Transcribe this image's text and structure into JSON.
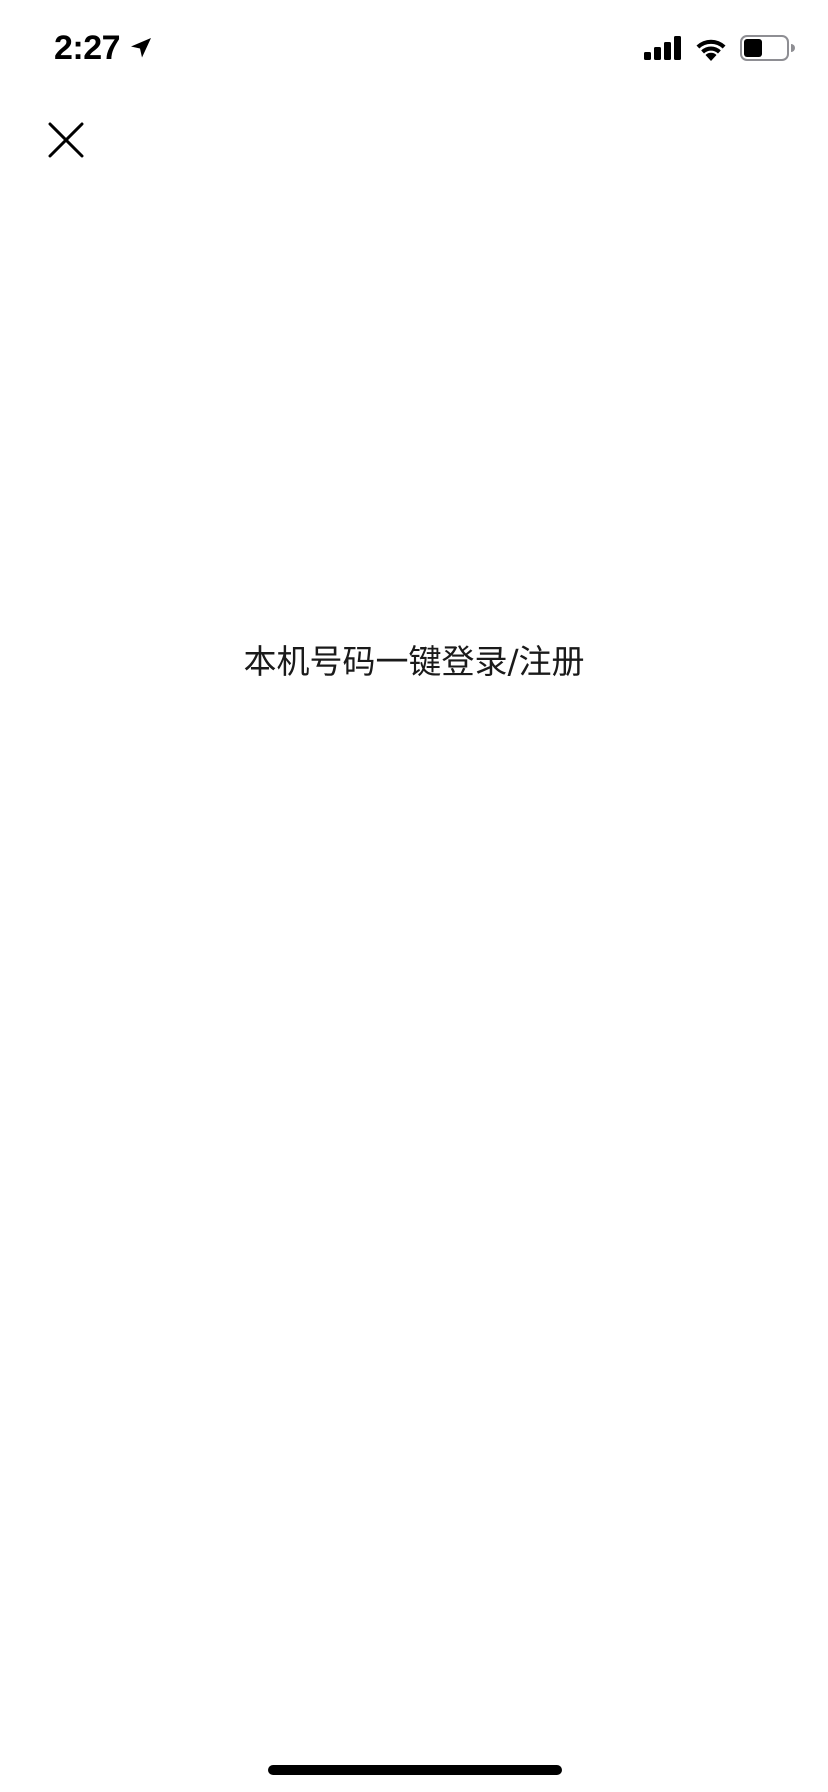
{
  "status_bar": {
    "time": "2:27",
    "location_icon": "location-arrow-icon",
    "signal_icon": "cellular-signal-icon",
    "wifi_icon": "wifi-icon",
    "battery_icon": "battery-icon",
    "battery_level": 0.45
  },
  "nav": {
    "close_icon": "close-icon"
  },
  "main": {
    "login_label": "本机号码一键登录/注册"
  },
  "colors": {
    "background": "#ffffff",
    "text": "#1a1a1a",
    "icon": "#000000"
  }
}
